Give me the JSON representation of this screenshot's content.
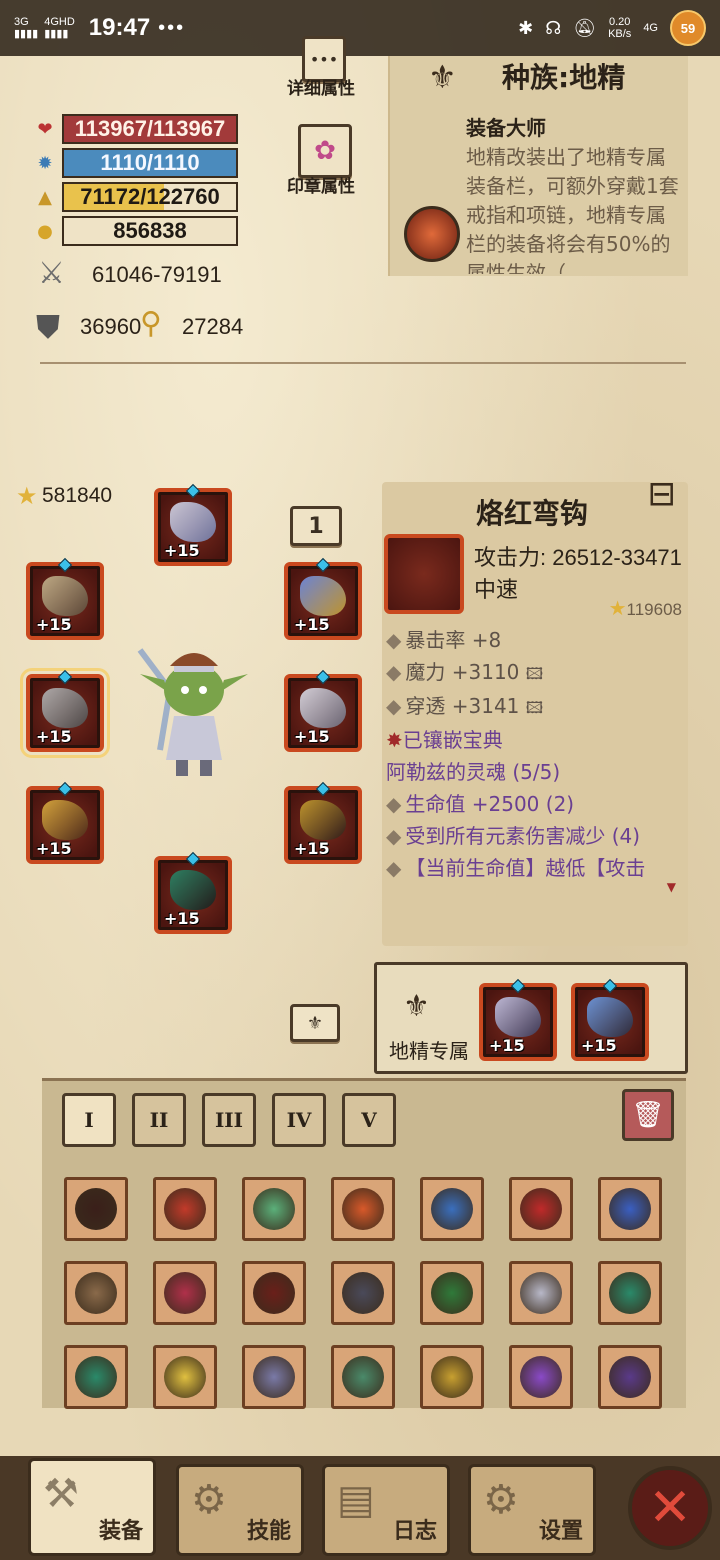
{
  "status_bar": {
    "network_left": "3G",
    "network_right": "4GHD",
    "time": "19:47",
    "dots": "•••",
    "speed_value": "0.20",
    "speed_unit": "KB/s",
    "net2": "4G",
    "avatar_badge": "59"
  },
  "side_buttons": {
    "details_label": "详细属性",
    "seal_label": "印章属性"
  },
  "stats": {
    "hp": "113967/113967",
    "mp": "1110/1110",
    "xp": "71172/122760",
    "xp_fraction": 0.58,
    "gold": "856838",
    "attack": "61046-79191",
    "defense": "36960",
    "magic_resist": "27284"
  },
  "race": {
    "title": "种族:地精",
    "ability_name": "装备大师",
    "ability_desc": "地精改装出了地精专属装备栏，可额外穿戴1套戒指和项链，地精专属栏的装备将会有50%的属性生效（"
  },
  "equipment": {
    "score": "581840",
    "set_number": "1",
    "slots": [
      {
        "name": "helmet",
        "level": "+15"
      },
      {
        "name": "shoulder",
        "level": "+15"
      },
      {
        "name": "weapon",
        "level": "+15"
      },
      {
        "name": "offhand",
        "level": "+15"
      },
      {
        "name": "cloak",
        "level": "+15"
      },
      {
        "name": "boots",
        "level": "+15"
      },
      {
        "name": "belt",
        "level": "+15"
      },
      {
        "name": "armor",
        "level": "+15"
      }
    ]
  },
  "item_detail": {
    "name": "烙红弯钩",
    "attack_line": "攻击力: 26512-33471",
    "speed": "中速",
    "score": "119608",
    "lines": [
      {
        "text": "暴击率 +8",
        "style": "grey"
      },
      {
        "text": "魔力 +3110",
        "style": "grey"
      },
      {
        "text": "穿透 +3141",
        "style": "grey"
      },
      {
        "text": "已镶嵌宝典",
        "style": "purple"
      },
      {
        "text": "阿勒兹的灵魂 (5/5)",
        "style": "purple"
      },
      {
        "text": "生命值 +2500 (2)",
        "style": "purple"
      },
      {
        "text": "受到所有元素伤害减少 (4)",
        "style": "purple"
      },
      {
        "text": "【当前生命值】越低【攻击",
        "style": "purple"
      }
    ]
  },
  "goblin_slot": {
    "label": "地精专属",
    "ring_level": "+15",
    "necklace_level": "+15"
  },
  "inventory": {
    "tabs": [
      "I",
      "II",
      "III",
      "IV",
      "V"
    ],
    "active_tab": 0,
    "trash_icon": "trash-icon",
    "item_colors": [
      "#3a1f1a",
      "#c23a2a",
      "#5bb07a",
      "#d8592a",
      "#3a6fbe",
      "#c02a2a",
      "#3a5fc2",
      "#8a6a4a",
      "#b0304a",
      "#6a1f1a",
      "#4a4a5a",
      "#2f7a3a",
      "#b8b8c8",
      "#2a8a6a",
      "#2a8a6a",
      "#e0c040",
      "#7a7aa8",
      "#4a8a6a",
      "#c8a030",
      "#8a4ac8",
      "#5a3a8a"
    ]
  },
  "bottom_nav": {
    "equip": "装备",
    "skills": "技能",
    "journal": "日志",
    "settings": "设置"
  }
}
